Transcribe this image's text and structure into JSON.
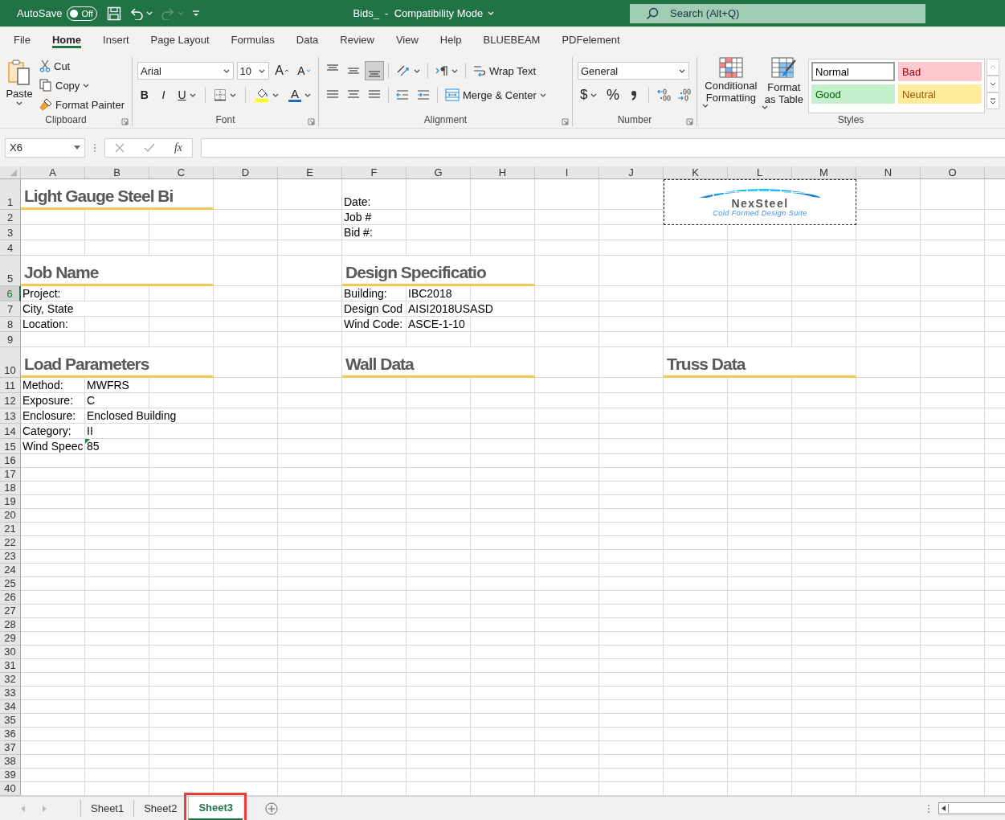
{
  "title_bar": {
    "autosave_label": "AutoSave",
    "autosave_on": false,
    "autosave_state": "Off",
    "document_title": "Bids_  -  Compatibility Mode",
    "search_placeholder": "Search (Alt+Q)"
  },
  "menu_tabs": [
    {
      "label": "File",
      "selected": false
    },
    {
      "label": "Home",
      "selected": true
    },
    {
      "label": "Insert",
      "selected": false
    },
    {
      "label": "Page Layout",
      "selected": false
    },
    {
      "label": "Formulas",
      "selected": false
    },
    {
      "label": "Data",
      "selected": false
    },
    {
      "label": "Review",
      "selected": false
    },
    {
      "label": "View",
      "selected": false
    },
    {
      "label": "Help",
      "selected": false
    },
    {
      "label": "BLUEBEAM",
      "selected": false
    },
    {
      "label": "PDFelement",
      "selected": false
    }
  ],
  "ribbon": {
    "clipboard": {
      "paste": "Paste",
      "cut": "Cut",
      "copy": "Copy",
      "format_painter": "Format Painter",
      "label": "Clipboard"
    },
    "font": {
      "font_name": "Arial",
      "font_size": "10",
      "grow_glyph": "A",
      "shrink_glyph": "A",
      "bold_glyph": "B",
      "italic_glyph": "I",
      "underline_glyph": "U",
      "font_color_glyph": "A",
      "label": "Font"
    },
    "alignment": {
      "vertical_align": [
        {
          "selected": false
        },
        {
          "selected": false
        },
        {
          "selected": true
        }
      ],
      "wrap_text": "Wrap Text",
      "merge_center": "Merge & Center",
      "label": "Alignment"
    },
    "number": {
      "format": "General",
      "currency_glyph": "$",
      "percent_glyph": "%",
      "label": "Number"
    },
    "styles": {
      "conditional_formatting": "Conditional Formatting",
      "format_as_table": "Format as Table",
      "label": "Styles",
      "gallery": [
        {
          "label": "Normal",
          "kind": "normal",
          "color": "#ffffff",
          "selected": true
        },
        {
          "label": "Bad",
          "kind": "bad",
          "color": "#ffc7ce",
          "selected": false
        },
        {
          "label": "Good",
          "kind": "good",
          "color": "#c6efce",
          "selected": false
        },
        {
          "label": "Neutral",
          "kind": "neutral",
          "color": "#ffeb9c",
          "selected": false
        }
      ]
    }
  },
  "formula_bar": {
    "name_box": "X6",
    "function_glyph": "fx"
  },
  "columns": [
    "A",
    "B",
    "C",
    "D",
    "E",
    "F",
    "G",
    "H",
    "I",
    "J",
    "K",
    "L",
    "M",
    "N",
    "O"
  ],
  "rows": [
    {
      "number": "1",
      "kind": "heading",
      "selected": false,
      "cells": {
        "A": {
          "kind": "heading",
          "text": "Light Gauge Steel Bi"
        },
        "B": {
          "kind": "merged"
        },
        "C": {
          "kind": "merged"
        },
        "F": {
          "kind": "value",
          "text": "Date:"
        }
      }
    },
    {
      "number": "2",
      "kind": "entry",
      "selected": false,
      "cells": {
        "F": {
          "kind": "value",
          "text": "Job #"
        }
      }
    },
    {
      "number": "3",
      "kind": "entry",
      "selected": false,
      "cells": {
        "F": {
          "kind": "value",
          "text": "Bid #:"
        }
      }
    },
    {
      "number": "4",
      "kind": "entry",
      "selected": false
    },
    {
      "number": "5",
      "kind": "heading",
      "selected": false,
      "cells": {
        "A": {
          "kind": "heading",
          "text": "Job Name"
        },
        "B": {
          "kind": "merged"
        },
        "C": {
          "kind": "merged"
        },
        "F": {
          "kind": "heading",
          "text": "Design Specificatio"
        },
        "G": {
          "kind": "merged"
        },
        "H": {
          "kind": "merged"
        }
      }
    },
    {
      "number": "6",
      "kind": "entry",
      "selected": true,
      "cells": {
        "A": {
          "kind": "value",
          "text": "Project:"
        },
        "F": {
          "kind": "value",
          "text": "Building:"
        },
        "G": {
          "kind": "value",
          "text": "IBC2018"
        }
      }
    },
    {
      "number": "7",
      "kind": "entry",
      "selected": false,
      "cells": {
        "A": {
          "kind": "value",
          "text": "City, State"
        },
        "F": {
          "kind": "value",
          "text": "Design Cod"
        },
        "G": {
          "kind": "value",
          "text": "AISI2018USASD"
        }
      }
    },
    {
      "number": "8",
      "kind": "entry",
      "selected": false,
      "cells": {
        "A": {
          "kind": "value",
          "text": "Location:"
        },
        "F": {
          "kind": "value",
          "text": "Wind Code:"
        },
        "G": {
          "kind": "value",
          "text": "ASCE-1-10"
        }
      }
    },
    {
      "number": "9",
      "kind": "entry",
      "selected": false
    },
    {
      "number": "10",
      "kind": "heading",
      "selected": false,
      "cells": {
        "A": {
          "kind": "heading",
          "text": "Load Parameters"
        },
        "B": {
          "kind": "merged"
        },
        "C": {
          "kind": "merged"
        },
        "F": {
          "kind": "heading",
          "text": "Wall Data"
        },
        "G": {
          "kind": "merged"
        },
        "H": {
          "kind": "merged"
        },
        "K": {
          "kind": "heading",
          "text": "Truss Data"
        },
        "L": {
          "kind": "merged"
        },
        "M": {
          "kind": "merged"
        }
      }
    },
    {
      "number": "11",
      "kind": "entry",
      "selected": false,
      "cells": {
        "A": {
          "kind": "value",
          "text": "Method:"
        },
        "B": {
          "kind": "value",
          "text": "MWFRS"
        }
      }
    },
    {
      "number": "12",
      "kind": "entry",
      "selected": false,
      "cells": {
        "A": {
          "kind": "value",
          "text": "Exposure:"
        },
        "B": {
          "kind": "value",
          "text": "C"
        }
      }
    },
    {
      "number": "13",
      "kind": "entry",
      "selected": false,
      "cells": {
        "A": {
          "kind": "value",
          "text": "Enclosure:"
        },
        "B": {
          "kind": "value",
          "text": "Enclosed Building"
        }
      }
    },
    {
      "number": "14",
      "kind": "entry",
      "selected": false,
      "cells": {
        "A": {
          "kind": "value",
          "text": "Category:"
        },
        "B": {
          "kind": "value",
          "text": "II"
        }
      }
    },
    {
      "number": "15",
      "kind": "entry",
      "selected": false,
      "cells": {
        "A": {
          "kind": "value",
          "text": "Wind Speec"
        },
        "B": {
          "kind": "value",
          "text": "85",
          "error_flag": true
        }
      }
    },
    {
      "number": "16",
      "kind": "empty",
      "selected": false
    },
    {
      "number": "17",
      "kind": "empty",
      "selected": false
    },
    {
      "number": "18",
      "kind": "empty",
      "selected": false
    },
    {
      "number": "19",
      "kind": "empty",
      "selected": false
    },
    {
      "number": "20",
      "kind": "empty",
      "selected": false
    },
    {
      "number": "21",
      "kind": "empty",
      "selected": false
    },
    {
      "number": "22",
      "kind": "empty",
      "selected": false
    },
    {
      "number": "23",
      "kind": "empty",
      "selected": false
    },
    {
      "number": "24",
      "kind": "empty",
      "selected": false
    },
    {
      "number": "25",
      "kind": "empty",
      "selected": false
    },
    {
      "number": "26",
      "kind": "empty",
      "selected": false
    },
    {
      "number": "27",
      "kind": "empty",
      "selected": false
    },
    {
      "number": "28",
      "kind": "empty",
      "selected": false
    },
    {
      "number": "29",
      "kind": "empty",
      "selected": false
    },
    {
      "number": "30",
      "kind": "empty",
      "selected": false
    },
    {
      "number": "31",
      "kind": "empty",
      "selected": false
    },
    {
      "number": "32",
      "kind": "empty",
      "selected": false
    },
    {
      "number": "33",
      "kind": "empty",
      "selected": false
    },
    {
      "number": "34",
      "kind": "empty",
      "selected": false
    },
    {
      "number": "35",
      "kind": "empty",
      "selected": false
    },
    {
      "number": "36",
      "kind": "empty",
      "selected": false
    },
    {
      "number": "37",
      "kind": "empty",
      "selected": false
    },
    {
      "number": "38",
      "kind": "empty",
      "selected": false
    },
    {
      "number": "39",
      "kind": "empty",
      "selected": false
    },
    {
      "number": "40",
      "kind": "empty",
      "selected": false
    }
  ],
  "logo": {
    "name": "NexSteel",
    "tagline": "Cold Formed Design Suite"
  },
  "sheet_tabs": [
    {
      "label": "Sheet1",
      "selected": false,
      "highlighted": false
    },
    {
      "label": "Sheet2",
      "selected": false,
      "highlighted": false
    },
    {
      "label": "Sheet3",
      "selected": true,
      "highlighted": true
    }
  ]
}
